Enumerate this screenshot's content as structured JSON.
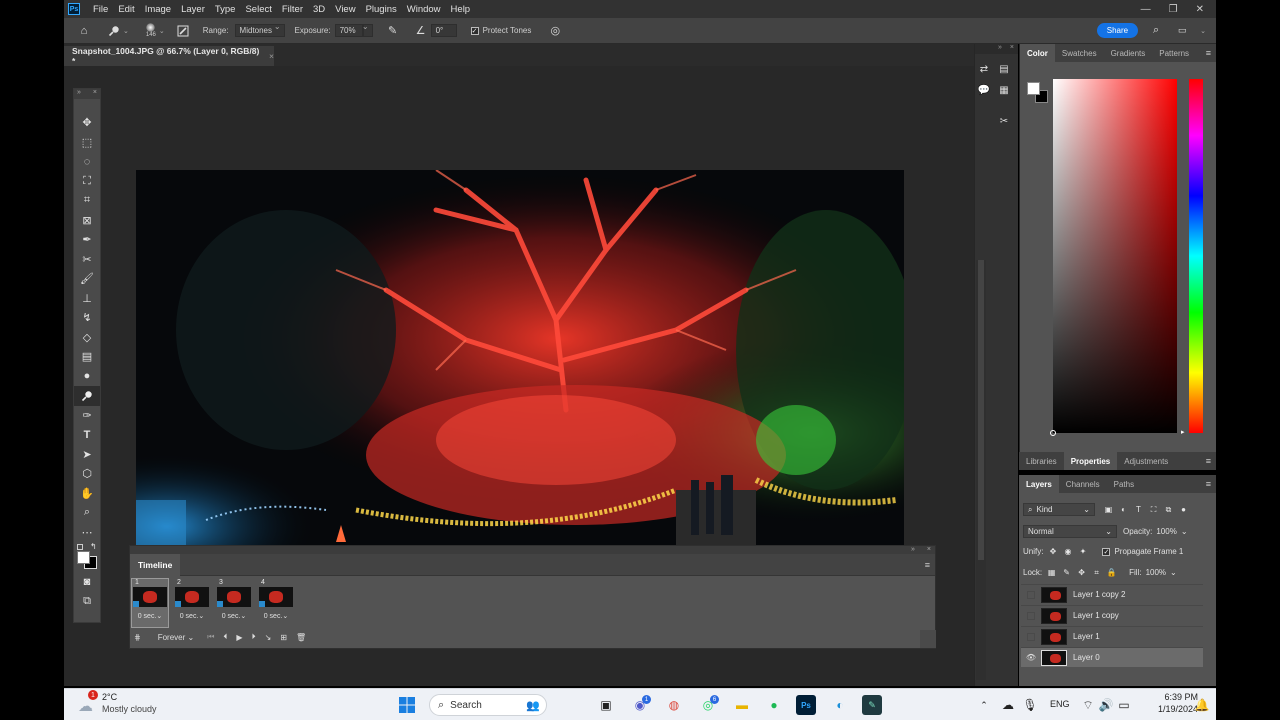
{
  "app": {
    "menu": [
      "File",
      "Edit",
      "Image",
      "Layer",
      "Type",
      "Select",
      "Filter",
      "3D",
      "View",
      "Plugins",
      "Window",
      "Help"
    ],
    "logo": "Ps"
  },
  "options_bar": {
    "brush_size": "146",
    "range_label": "Range:",
    "range_value": "Midtones",
    "exposure_label": "Exposure:",
    "exposure_value": "70%",
    "angle_value": "0°",
    "protect_tones_label": "Protect Tones",
    "protect_tones_checked": true,
    "share_label": "Share"
  },
  "document": {
    "tab_title": "Snapshot_1004.JPG @ 66.7% (Layer 0, RGB/8) *"
  },
  "timeline": {
    "title": "Timeline",
    "frames": [
      {
        "num": "1",
        "delay": "0 sec.",
        "selected": true
      },
      {
        "num": "2",
        "delay": "0 sec.",
        "selected": false
      },
      {
        "num": "3",
        "delay": "0 sec.",
        "selected": false
      },
      {
        "num": "4",
        "delay": "0 sec.",
        "selected": false
      }
    ],
    "loop": "Forever"
  },
  "color_panel": {
    "tabs": [
      "Color",
      "Swatches",
      "Gradients",
      "Patterns"
    ],
    "active_tab": "Color",
    "foreground": "#ffffff",
    "background": "#000000"
  },
  "properties_tabs": {
    "tabs": [
      "Libraries",
      "Properties",
      "Adjustments"
    ],
    "active_tab": "Properties"
  },
  "layers_panel": {
    "tabs": [
      "Layers",
      "Channels",
      "Paths"
    ],
    "active_tab": "Layers",
    "filter_kind": "Kind",
    "blend_mode": "Normal",
    "opacity_label": "Opacity:",
    "opacity": "100%",
    "unify_label": "Unify:",
    "propagate_label": "Propagate Frame 1",
    "lock_label": "Lock:",
    "fill_label": "Fill:",
    "fill": "100%",
    "layers": [
      {
        "name": "Layer 1 copy 2",
        "visible": false,
        "selected": false
      },
      {
        "name": "Layer 1 copy",
        "visible": false,
        "selected": false
      },
      {
        "name": "Layer 1",
        "visible": false,
        "selected": false
      },
      {
        "name": "Layer 0",
        "visible": true,
        "selected": true
      }
    ]
  },
  "taskbar": {
    "weather_temp": "2°C",
    "weather_desc": "Mostly cloudy",
    "weather_badge": "1",
    "search_label": "Search",
    "lang": "ENG",
    "time": "6:39 PM",
    "date": "1/19/2024",
    "teams_badge": "1",
    "whatsapp_badge": "6"
  }
}
